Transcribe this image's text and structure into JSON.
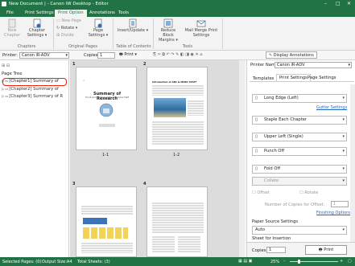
{
  "window": {
    "title": "New Document | - Canon iW Desktop - Editor"
  },
  "tabs": [
    "File",
    "Print Settings",
    "Print Option",
    "Annotations",
    "Tools"
  ],
  "ribbon": {
    "new_chapter": "New Chapter",
    "chapter_settings": "Chapter Settings",
    "chapter_settings_dd": "▾",
    "group_chapters": "Chapters",
    "new_page": "New Page",
    "rotate": "Rotate",
    "divide": "Divide",
    "group_original_pages": "Original Pages",
    "page_settings": "Page Settings",
    "insert_update": "Insert/Update",
    "group_toc": "Table of Contents",
    "reduce_block_margins": "Reduce Block Margins",
    "mail_merge": "Mail Merge Print Settings",
    "group_tools": "Tools"
  },
  "toolbar": {
    "printer_label": "Printer:",
    "printer_value": "Canon iR-ADV",
    "copies_label": "Copies:",
    "copies_value": "1",
    "print_label": "Print",
    "display_annotations": "Display Annotations"
  },
  "page_tree": {
    "title": "Page Tree",
    "items": [
      "[Chapter1] Summary of",
      "[Chapter2] Summary of",
      "[Chapter3] Summary of R"
    ]
  },
  "pages": [
    {
      "number": "1",
      "label": "1-1",
      "title": "Summary of Research",
      "subtitle": "The Board Members of Ms. R. General Staff"
    },
    {
      "number": "2",
      "label": "1-2",
      "title": "Introduction of ABC & MOBC STAFF"
    },
    {
      "number": "3"
    },
    {
      "number": "4"
    }
  ],
  "right_panel": {
    "printer_label": "Printer Name:",
    "printer_value": "Canon iR-ADV",
    "tabs": [
      "Templates",
      "Print Settings",
      "Page Settings"
    ],
    "options": [
      "Long Edge (Left)",
      "Staple Each Chapter",
      "Upper Left (Single)",
      "Punch Off",
      "Fold Off",
      "Collate"
    ],
    "gutter_link": "Gutter Settings",
    "offset_label": "Offset",
    "rotate_label": "Rotate",
    "num_copies_label": "Number of Copies for Offset:",
    "num_copies_value": "1",
    "finishing_link": "Finishing Options",
    "paper_source_label": "Paper Source Settings",
    "paper_source_value": "Auto",
    "sheet_insertion": "Sheet for Insertion",
    "copies_label": "Copies:",
    "copies_value": "1",
    "print_button": "Print"
  },
  "status": {
    "selected": "Selected Pages: (0)",
    "output": "Output Size:A4",
    "total": "Total Sheets: (3)",
    "zoom": "25%"
  }
}
